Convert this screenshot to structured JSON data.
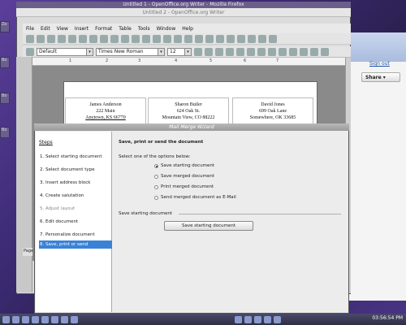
{
  "windows": {
    "writer_title_top": "Untitled 1 - OpenOffice.org Writer - Mozilla Firefox",
    "writer_title": "Untitled 2 - OpenOffice.org Writer"
  },
  "menu": [
    "File",
    "Edit",
    "View",
    "Insert",
    "Format",
    "Table",
    "Tools",
    "Window",
    "Help"
  ],
  "format_toolbar": {
    "style": "Default",
    "font": "Times New Roman",
    "size": "12"
  },
  "browser": {
    "sign_out": "Sign out",
    "share": "Share"
  },
  "labels": [
    {
      "name": "James Anderson",
      "street": "222 Main",
      "city": "Anytown, KS 66770"
    },
    {
      "name": "Sharon Butler",
      "street": "624 Oak St.",
      "city": "Mountain View, CO 88222"
    },
    {
      "name": "David Jones",
      "street": "699 Oak Lane",
      "city": "Somewhere, OK 33685"
    }
  ],
  "dialog": {
    "title": "Mail Merge Wizard",
    "steps_header": "Steps",
    "steps": [
      "1. Select starting document",
      "2. Select document type",
      "3. Insert address block",
      "4. Create salutation",
      "5. Adjust layout",
      "6. Edit document",
      "7. Personalize document",
      "8. Save, print or send"
    ],
    "heading": "Save, print or send the document",
    "prompt": "Select one of the options below:",
    "options": [
      "Save starting document",
      "Save merged document",
      "Print merged document",
      "Send merged document as E-Mail"
    ],
    "section_label": "Save starting document",
    "save_button": "Save starting document"
  },
  "status": {
    "page": "Page"
  },
  "taskbar": {
    "clock": "03:56:54 PM"
  }
}
